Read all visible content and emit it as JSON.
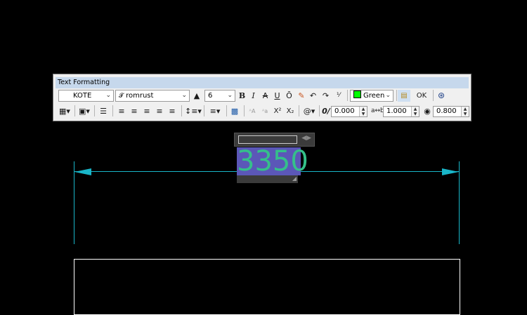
{
  "toolbar": {
    "title": "Text Formatting",
    "style": {
      "value": "KOTE"
    },
    "font": {
      "value": "romrust",
      "icon": "truetype-font-icon"
    },
    "height": {
      "value": "6"
    },
    "bold_label": "B",
    "italic_label": "I",
    "strike_label": "A",
    "underline_label": "U",
    "overline_label": "Ō",
    "color": {
      "value": "Green",
      "swatch": "#00ff00"
    },
    "ok_label": "OK",
    "oblique": {
      "value": "0.000"
    },
    "tracking": {
      "value": "1.000"
    },
    "width_factor": {
      "value": "0.800"
    },
    "superscript_label": "X²",
    "subscript_label": "X₂"
  },
  "drawing": {
    "dimension_text": "3350",
    "colors": {
      "dimension": "#19b6c9",
      "text": "#35c08a",
      "edit_bg": "#5b57b8"
    }
  }
}
